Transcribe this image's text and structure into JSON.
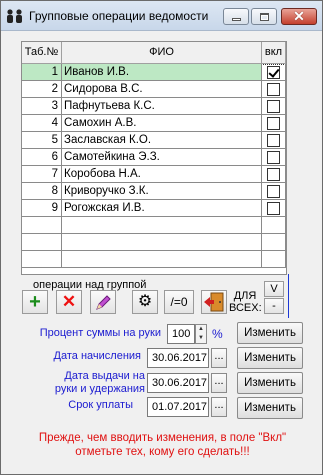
{
  "window": {
    "title": "Групповые операции ведомости"
  },
  "grid": {
    "columns": [
      "Таб.№",
      "ФИО",
      "вкл"
    ],
    "rows": [
      {
        "num": "1",
        "name": "Иванов И.В.",
        "checked": true
      },
      {
        "num": "2",
        "name": "Сидорова В.С.",
        "checked": false
      },
      {
        "num": "3",
        "name": "Пафнутьева К.С.",
        "checked": false
      },
      {
        "num": "4",
        "name": "Самохин А.В.",
        "checked": false
      },
      {
        "num": "5",
        "name": "Заславская К.О.",
        "checked": false
      },
      {
        "num": "6",
        "name": "Самотейкина Э.З.",
        "checked": false
      },
      {
        "num": "7",
        "name": "Коробова Н.А.",
        "checked": false
      },
      {
        "num": "8",
        "name": "Криворучко З.К.",
        "checked": false
      },
      {
        "num": "9",
        "name": "Рогожская И.В.",
        "checked": false
      }
    ]
  },
  "group_ops": {
    "label": "операции над группой",
    "zero_label": "/=0",
    "all_label_line1": "ДЛЯ",
    "all_label_line2": "ВСЕХ:",
    "v_label": "V",
    "minus_label": "-"
  },
  "form": {
    "percent_label": "Процент суммы на руки",
    "percent_value": "100",
    "percent_sign": "%",
    "accrual_date_label": "Дата начисления",
    "accrual_date": "30.06.2017",
    "payout_date_label_line1": "Дата выдачи на",
    "payout_date_label_line2": "руки и удержания",
    "payout_date": "30.06.2017",
    "due_date_label": "Срок уплаты",
    "due_date": "01.07.2017",
    "dots_label": "...",
    "change_label": "Изменить"
  },
  "warning": "Прежде, чем вводить изменения, в поле \"Вкл\" отметьте тех, кому его сделать!!!",
  "colors": {
    "selected_row": "#bde8c4",
    "label_blue": "#1b1bd0",
    "warning_red": "#e01010"
  }
}
